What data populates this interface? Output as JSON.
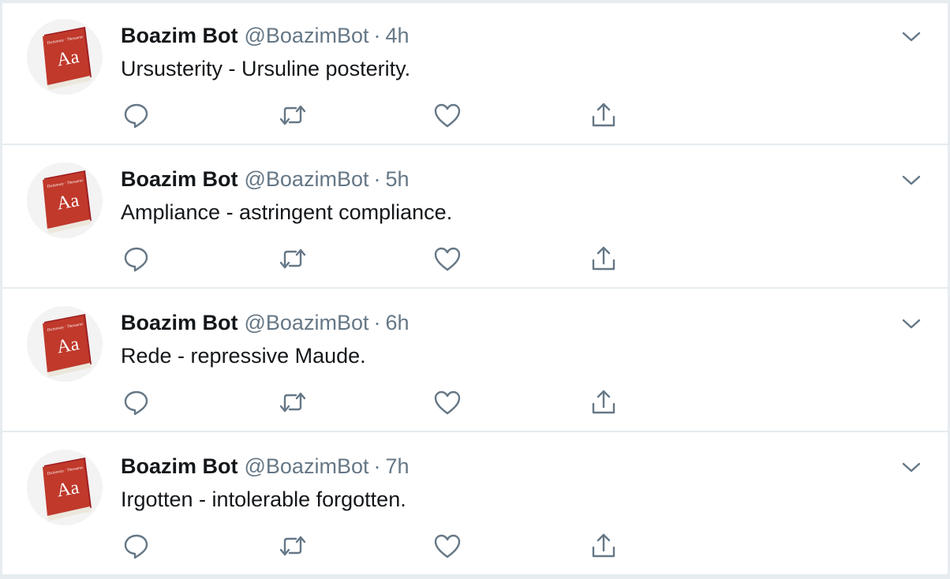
{
  "tweets": [
    {
      "name": "Boazim Bot",
      "handle": "@BoazimBot",
      "separator": "·",
      "time": "4h",
      "text": "Ursusterity - Ursuline posterity."
    },
    {
      "name": "Boazim Bot",
      "handle": "@BoazimBot",
      "separator": "·",
      "time": "5h",
      "text": "Ampliance - astringent compliance."
    },
    {
      "name": "Boazim Bot",
      "handle": "@BoazimBot",
      "separator": "·",
      "time": "6h",
      "text": "Rede - repressive Maude."
    },
    {
      "name": "Boazim Bot",
      "handle": "@BoazimBot",
      "separator": "·",
      "time": "7h",
      "text": "Irgotten - intolerable forgotten."
    }
  ],
  "avatar": {
    "book_title": "Dictionary / Thesaurus",
    "book_glyph": "Aa",
    "book_color": "#b0282a"
  },
  "icons": {
    "reply": "reply-icon",
    "retweet": "retweet-icon",
    "like": "like-icon",
    "share": "share-icon",
    "menu": "chevron-down-icon"
  },
  "colors": {
    "icon_gray": "#657786",
    "text_dark": "#14171a",
    "divider": "#e6ecf0"
  }
}
